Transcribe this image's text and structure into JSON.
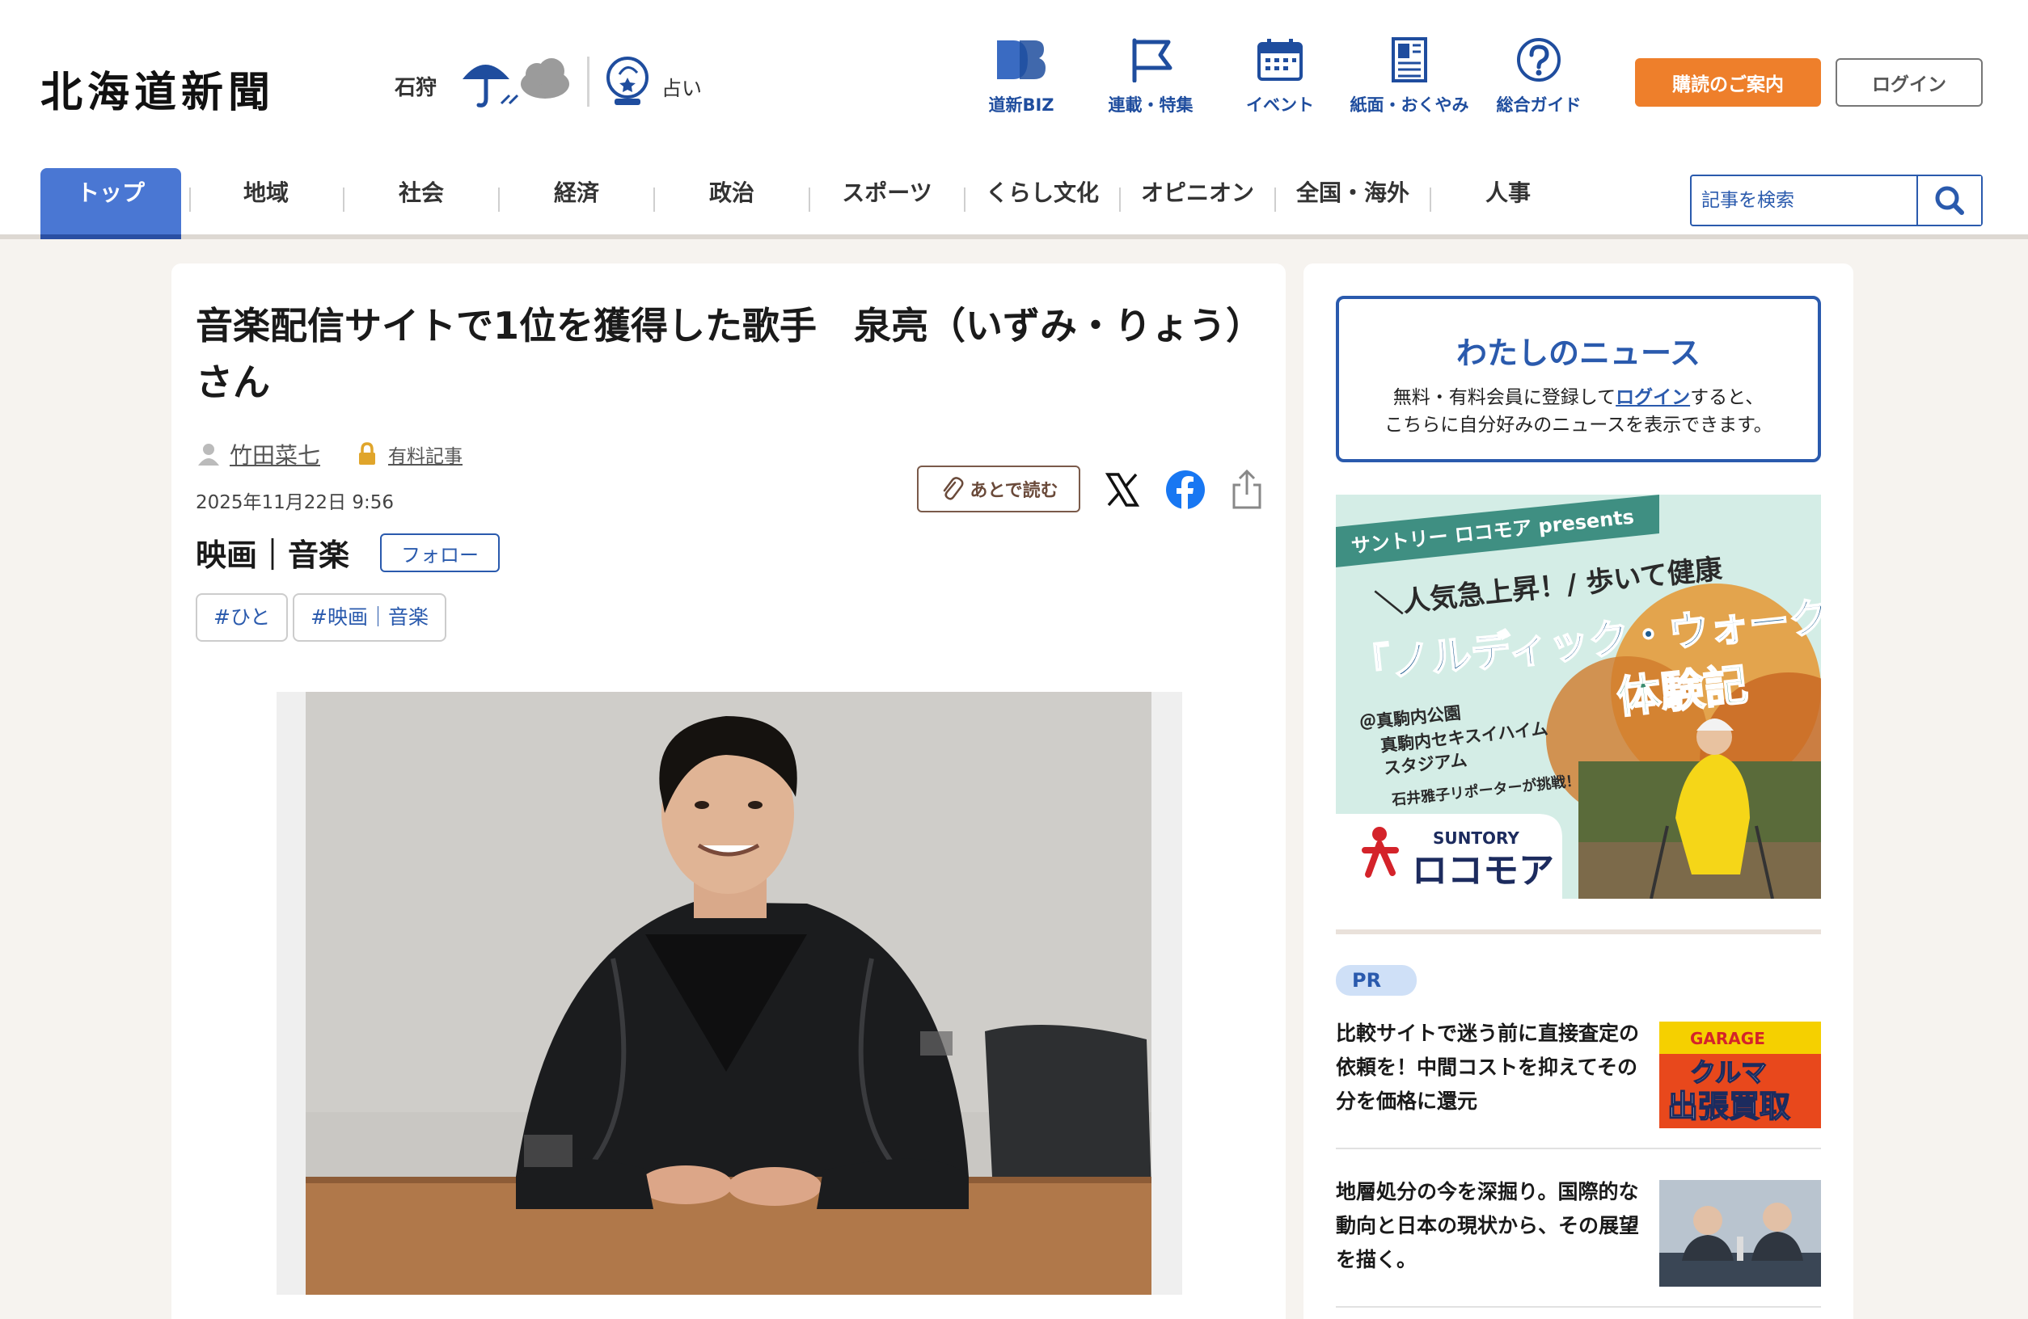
{
  "header": {
    "logo": "北海道新聞",
    "region": "石狩",
    "fortune": "占い",
    "nav": [
      {
        "label": "道新BIZ",
        "icon": "db-icon"
      },
      {
        "label": "連載・特集",
        "icon": "flag-icon"
      },
      {
        "label": "イベント",
        "icon": "calendar-icon"
      },
      {
        "label": "紙面・おくやみ",
        "icon": "newspaper-icon"
      },
      {
        "label": "総合ガイド",
        "icon": "help-icon"
      }
    ],
    "subscribe_label": "購読のご案内",
    "login_label": "ログイン"
  },
  "categories": [
    "トップ",
    "地域",
    "社会",
    "経済",
    "政治",
    "スポーツ",
    "くらし文化",
    "オピニオン",
    "全国・海外",
    "人事"
  ],
  "search": {
    "placeholder": "記事を検索"
  },
  "article": {
    "title": "音楽配信サイトで1位を獲得した歌手　泉亮（いずみ・りょう）さん",
    "author": "竹田菜七",
    "paid_label": "有料記事",
    "date": "2025年11月22日 9:56",
    "genre": "映画｜音楽",
    "follow_label": "フォロー",
    "tags": [
      "#ひと",
      "#映画｜音楽"
    ],
    "read_later_label": "あとで読む"
  },
  "sidebar": {
    "mynews_title": "わたしのニュース",
    "mynews_text_before": "無料・有料会員に登録して",
    "mynews_link": "ログイン",
    "mynews_text_after": "すると、",
    "mynews_text_line2": "こちらに自分好みのニュースを表示できます。",
    "ad": {
      "ribbon": "サントリー ロコモア presents",
      "line1": "＼人気急上昇！/ 歩いて健康",
      "line2": "「ノルディック・ウォーク」",
      "line3": "体験記",
      "place1": "＠真駒内公園",
      "place2": "真駒内セキスイハイム",
      "place3": "スタジアム",
      "reporter": "石井雅子リポーターが挑戦！",
      "brand": "SUNTORY",
      "product": "ロコモア"
    },
    "pr_label": "PR",
    "pr_items": [
      {
        "text": "比較サイトで迷う前に直接査定の依頼を！中間コストを抑えてその分を価格に還元",
        "thumb_line1": "クルマ",
        "thumb_line2": "出張買取",
        "thumb_top": "GARAGE"
      },
      {
        "text": "地層処分の今を深掘り。国際的な動向と日本の現状から、その展望を描く。"
      }
    ]
  },
  "colors": {
    "brand_blue": "#2a5aad",
    "active_tab": "#4a77d3",
    "subscribe_orange": "#ee7f2b",
    "page_bg": "#f6f3ef"
  }
}
